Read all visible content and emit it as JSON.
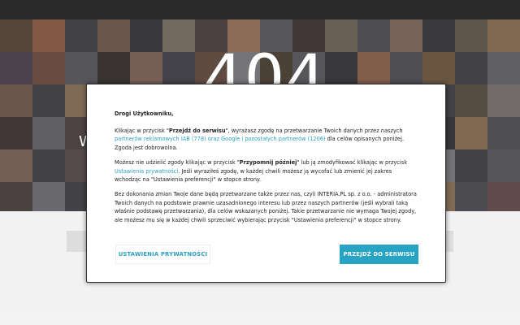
{
  "page": {
    "error_code": "404",
    "hero_sub_fragment": "W"
  },
  "consent": {
    "greeting": "Drogi Użytkowniku,",
    "p1": {
      "t1": "Klikając w przycisk \"",
      "b1": "Przejdź do serwisu",
      "t2": "\", wyrażasz zgodę na przetwarzanie Twoich danych przez naszych ",
      "l1": "partnerów reklamowych IAB (778) oraz Google i pozostałych partnerów (1206)",
      "t3": " dla celów opisanych poniżej. Zgoda jest dobrowolna."
    },
    "p2": {
      "t1": "Możesz nie udzielić zgody klikając w przycisk \"",
      "b1": "Przypomnij później",
      "t2": "\" lub ją zmodyfikować klikając w przycisk ",
      "l1": "Ustawienia prywatności",
      "t3": ". Jeśli wyraziłeś zgodę, w każdej chwili możesz ją wycofać lub zmienić jej zakres wchodząc na \"Ustawienia preferencji\" w stopce strony."
    },
    "p3": "Bez dokonania zmian Twoje dane będą przetwarzane także przez nas, czyli INTERIA.PL sp. z o.o. - administratora Twoich danych na podstawie prawnie uzasadnionego interesu lub przez naszych partnerów (jeśli wybrali taką właśnie podstawę przetwarzania), dla celów wskazanych poniżej. Takie przetwarzanie nie wymaga Twojej zgody, ale możesz mu się w każdej chwili sprzeciwić wybierając przycisk \"Ustawienia preferencji\" w stopce strony.",
    "settings_button": "USTAWIENIA PRYWATNOŚCI",
    "accept_button": "PRZEJDŹ DO SERWISU",
    "link_color": "#2a9fbf",
    "accent_color": "#27a3c4"
  },
  "hero_tiles": [
    "#6a5040",
    "#b07050",
    "#4a4a52",
    "#8a6a5a",
    "#3c3c44",
    "#9a8a7a",
    "#5a4a4a",
    "#c09070",
    "#6e6e76",
    "#4a3a3a",
    "#8a7a6a",
    "#5c5c64",
    "#a08070",
    "#3e3e46",
    "#7a6a5a",
    "#b08868",
    "#5a4a5a",
    "#8a5a4a",
    "#6a6a72",
    "#3c3430",
    "#a07a6a",
    "#4e4e56",
    "#7a5a4a",
    "#9a9aa2",
    "#5a4a3a",
    "#6c6c74",
    "#3a3a42",
    "#b07858",
    "#5e5e66",
    "#8a6a4a",
    "#4a4a52",
    "#7a7a82",
    "#8a6a5a",
    "#4c4c54",
    "#b08a6a",
    "#5a5a62",
    "#7a4a3a",
    "#9a9aa0",
    "#4a3a3a",
    "#6a6a72",
    "#c08060",
    "#3e3e46",
    "#8a7a6a",
    "#5a5a62",
    "#a07050",
    "#4a4a52",
    "#6a5a4a",
    "#9a8a8a",
    "#4a3a3a",
    "#7a7a82",
    "#5c4c4c",
    "#9a6a5a",
    "#3e3e46",
    "#8a8a92",
    "#6a4a3a",
    "#4e4e56",
    "#7a6a5a",
    "#a0a0a8",
    "#5a4a4a",
    "#8a5a4a",
    "#6c6c74",
    "#3a3a42",
    "#b08868",
    "#5e5e66",
    "#9a7a6a",
    "#4a4a52",
    "#6a5a5a",
    "#3c3c44",
    "#a08070",
    "#5a5a62",
    "#7a7a82",
    "#4a3a3a",
    "#8a6a5a",
    "#5c5c64",
    "#b07858",
    "#3e3e46",
    "#7a5a4a",
    "#9a9aa2",
    "#4a4a52",
    "#6a6a72",
    "#5a4a4a",
    "#8a8a92",
    "#4c4c54",
    "#a07060",
    "#6a6a72",
    "#3a3a42",
    "#8a6a4a",
    "#5e5e66",
    "#7a6a6a",
    "#4a4a52",
    "#9a7a6a",
    "#6e6e76",
    "#3c3c44",
    "#b08a6a",
    "#5a5a62",
    "#7a5a5a"
  ]
}
